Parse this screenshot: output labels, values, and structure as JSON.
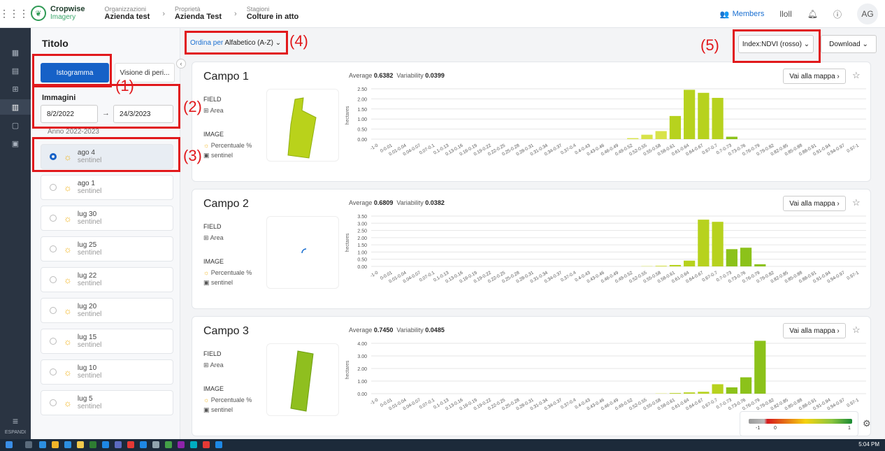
{
  "header": {
    "logo_name": "Cropwise",
    "logo_sub": "Imagery",
    "breadcrumbs": [
      {
        "small": "Organizzazioni",
        "big": "Azienda test"
      },
      {
        "small": "Proprietà",
        "big": "Azienda Test"
      },
      {
        "small": "Stagioni",
        "big": "Colture in atto"
      }
    ],
    "members_label": "Members",
    "avatar_initials": "AG",
    "bars_label": "lloll"
  },
  "rail": {
    "expand_label": "ESPANDI"
  },
  "left_panel": {
    "title": "Titolo",
    "tab_histogram": "Istogramma",
    "tab_visione": "Visione di peri...",
    "images_label": "Immagini",
    "date_from": "8/2/2022",
    "date_to": "24/3/2023",
    "year_label": "Anno 2022-2023",
    "items": [
      {
        "date": "ago 4",
        "source": "sentinel"
      },
      {
        "date": "ago 1",
        "source": "sentinel"
      },
      {
        "date": "lug 30",
        "source": "sentinel"
      },
      {
        "date": "lug 25",
        "source": "sentinel"
      },
      {
        "date": "lug 22",
        "source": "sentinel"
      },
      {
        "date": "lug 20",
        "source": "sentinel"
      },
      {
        "date": "lug 15",
        "source": "sentinel"
      },
      {
        "date": "lug 10",
        "source": "sentinel"
      },
      {
        "date": "lug 5",
        "source": "sentinel"
      }
    ]
  },
  "toolbar": {
    "sort_label": "Ordina per",
    "sort_value": "Alfabetico (A-Z)",
    "index_value": "Index:NDVI (rosso)",
    "download_label": "Download"
  },
  "annotations": [
    "(1)",
    "(2)",
    "(3)",
    "(4)",
    "(5)"
  ],
  "card_labels": {
    "field": "FIELD",
    "area": "Area",
    "image": "IMAGE",
    "percent": "Percentuale %",
    "source": "sentinel",
    "average": "Average",
    "variability": "Variability",
    "vai": "Vai alla mappa",
    "ylabel": "hectares"
  },
  "chart_data": [
    {
      "type": "bar",
      "title": "Campo 1",
      "average": "0.6382",
      "variability": "0.0399",
      "ylabel": "hectares",
      "ticks": [
        "0.00",
        "0.50",
        "1.00",
        "1.50",
        "2.00",
        "2.50"
      ],
      "ylim": [
        0,
        2.5
      ],
      "categories": [
        "-1-0",
        "0-0.01",
        "0.01-0.04",
        "0.04-0.07",
        "0.07-0.1",
        "0.1-0.13",
        "0.13-0.16",
        "0.16-0.19",
        "0.19-0.22",
        "0.22-0.25",
        "0.25-0.28",
        "0.28-0.31",
        "0.31-0.34",
        "0.34-0.37",
        "0.37-0.4",
        "0.4-0.43",
        "0.43-0.46",
        "0.46-0.49",
        "0.49-0.52",
        "0.52-0.55",
        "0.55-0.58",
        "0.58-0.61",
        "0.61-0.64",
        "0.64-0.67",
        "0.67-0.7",
        "0.7-0.73",
        "0.73-0.76",
        "0.76-0.79",
        "0.79-0.82",
        "0.82-0.85",
        "0.85-0.88",
        "0.88-0.91",
        "0.91-0.94",
        "0.94-0.97",
        "0.97-1"
      ],
      "values": [
        0,
        0,
        0,
        0,
        0,
        0,
        0,
        0,
        0,
        0,
        0,
        0,
        0,
        0,
        0,
        0,
        0,
        0,
        0.05,
        0.22,
        0.4,
        1.15,
        2.45,
        2.3,
        2.05,
        0.12,
        0,
        0,
        0,
        0,
        0,
        0,
        0,
        0,
        0
      ]
    },
    {
      "type": "bar",
      "title": "Campo 2",
      "average": "0.6809",
      "variability": "0.0382",
      "ylabel": "hectares",
      "ticks": [
        "0.00",
        "0.50",
        "1.00",
        "1.50",
        "2.00",
        "2.50",
        "3.00",
        "3.50"
      ],
      "ylim": [
        0,
        3.5
      ],
      "categories": [
        "-1-0",
        "0-0.01",
        "0.01-0.04",
        "0.04-0.07",
        "0.07-0.1",
        "0.1-0.13",
        "0.13-0.16",
        "0.16-0.19",
        "0.19-0.22",
        "0.22-0.25",
        "0.25-0.28",
        "0.28-0.31",
        "0.31-0.34",
        "0.34-0.37",
        "0.37-0.4",
        "0.4-0.43",
        "0.43-0.46",
        "0.46-0.49",
        "0.49-0.52",
        "0.52-0.55",
        "0.55-0.58",
        "0.58-0.61",
        "0.61-0.64",
        "0.64-0.67",
        "0.67-0.7",
        "0.7-0.73",
        "0.73-0.76",
        "0.76-0.79",
        "0.79-0.82",
        "0.82-0.85",
        "0.85-0.88",
        "0.88-0.91",
        "0.91-0.94",
        "0.94-0.97",
        "0.97-1"
      ],
      "values": [
        0,
        0,
        0,
        0,
        0,
        0,
        0,
        0,
        0,
        0,
        0,
        0,
        0,
        0,
        0,
        0,
        0,
        0,
        0,
        0.02,
        0.05,
        0.1,
        0.4,
        3.25,
        3.1,
        1.2,
        1.3,
        0.15,
        0,
        0,
        0,
        0,
        0,
        0,
        0
      ]
    },
    {
      "type": "bar",
      "title": "Campo 3",
      "average": "0.7450",
      "variability": "0.0485",
      "ylabel": "hectares",
      "ticks": [
        "0.00",
        "1.00",
        "2.00",
        "3.00",
        "4.00"
      ],
      "ylim": [
        0,
        4
      ],
      "categories": [
        "-1-0",
        "0-0.01",
        "0.01-0.04",
        "0.04-0.07",
        "0.07-0.1",
        "0.1-0.13",
        "0.13-0.16",
        "0.16-0.19",
        "0.19-0.22",
        "0.22-0.25",
        "0.25-0.28",
        "0.28-0.31",
        "0.31-0.34",
        "0.34-0.37",
        "0.37-0.4",
        "0.4-0.43",
        "0.43-0.46",
        "0.46-0.49",
        "0.49-0.52",
        "0.52-0.55",
        "0.55-0.58",
        "0.58-0.61",
        "0.61-0.64",
        "0.64-0.67",
        "0.67-0.7",
        "0.7-0.73",
        "0.73-0.76",
        "0.76-0.79",
        "0.79-0.82",
        "0.82-0.85",
        "0.85-0.88",
        "0.88-0.91",
        "0.91-0.94",
        "0.94-0.97",
        "0.97-1"
      ],
      "values": [
        0,
        0,
        0,
        0,
        0,
        0,
        0,
        0,
        0,
        0,
        0,
        0,
        0,
        0,
        0,
        0,
        0,
        0,
        0,
        0,
        0.02,
        0.05,
        0.1,
        0.15,
        0.75,
        0.5,
        1.3,
        4.2,
        0,
        0,
        0,
        0,
        0,
        0,
        0
      ]
    }
  ],
  "legend": {
    "min": "-1",
    "zero": "0",
    "max": "1"
  },
  "taskbar": {
    "time": "5:04 PM"
  },
  "colors": {
    "primary": "#1661c7",
    "annotation": "#e1191c",
    "rail": "#2a3442"
  }
}
